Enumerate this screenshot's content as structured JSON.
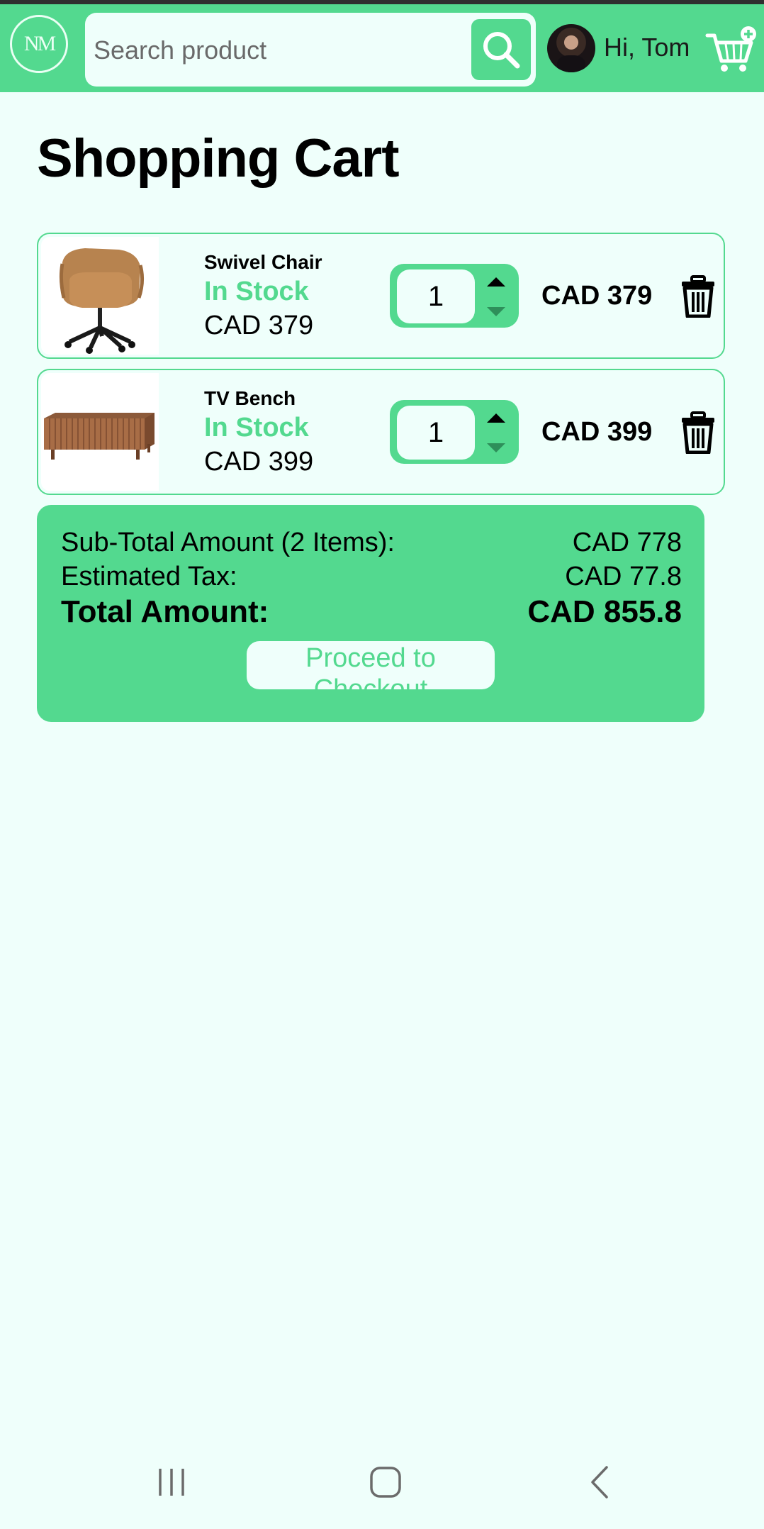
{
  "header": {
    "logo_text": "NM",
    "search_placeholder": "Search product",
    "greeting": "Hi, Tom"
  },
  "page_title": "Shopping Cart",
  "cart": {
    "items": [
      {
        "name": "Swivel Chair",
        "stock": "In Stock",
        "price": "CAD 379",
        "quantity": "1",
        "total": "CAD 379"
      },
      {
        "name": "TV Bench",
        "stock": "In Stock",
        "price": "CAD 399",
        "quantity": "1",
        "total": "CAD 399"
      }
    ]
  },
  "summary": {
    "subtotal_label": "Sub-Total Amount (2 Items):",
    "subtotal_value": "CAD 778",
    "tax_label": "Estimated Tax:",
    "tax_value": "CAD 77.8",
    "total_label": "Total Amount:",
    "total_value": "CAD 855.8",
    "checkout_label": "Proceed to Checkout"
  },
  "colors": {
    "brand_green": "#53d98f",
    "background": "#effffb"
  },
  "icons": [
    "search-icon",
    "cart-add-icon",
    "trash-icon",
    "chevron-up-icon",
    "chevron-down-icon",
    "recent-apps-icon",
    "home-icon",
    "back-icon"
  ]
}
